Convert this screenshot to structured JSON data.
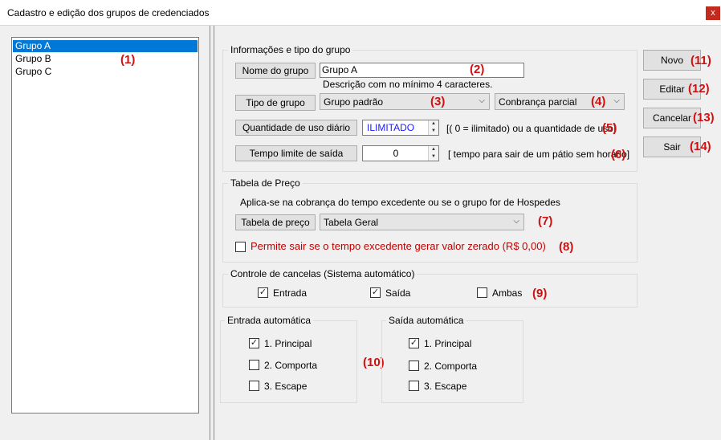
{
  "window": {
    "title": "Cadastro e edição dos grupos de credenciados",
    "close_glyph": "x"
  },
  "list": {
    "items": [
      "Grupo A",
      "Grupo B",
      "Grupo C"
    ],
    "selected_index": 0
  },
  "groups": {
    "info": "Informações e tipo do grupo",
    "price": "Tabela de Preço",
    "gates": "Controle de cancelas (Sistema automático)",
    "entry_auto": "Entrada automática",
    "exit_auto": "Saída automática"
  },
  "info": {
    "name_button": "Nome do grupo",
    "name_value": "Grupo A",
    "name_hint": "Descrição com no mínimo 4 caracteres.",
    "type_button": "Tipo de grupo",
    "type_value": "Grupo padrão",
    "charge_value": "Conbrança parcial",
    "usage_button": "Quantidade de uso diário",
    "usage_value": "ILIMITADO",
    "usage_hint": "[( 0 = ilimitado) ou a quantidade de uso]",
    "time_button": "Tempo limite de saída",
    "time_value": "0",
    "time_hint": "[ tempo para sair de um pátio sem horário]"
  },
  "price": {
    "description": "Aplica-se na cobrança do tempo excedente ou se o grupo for de Hospedes",
    "table_button": "Tabela de preço",
    "table_value": "Tabela Geral",
    "zero_checkbox_label": "Permite sair se o tempo excedente gerar valor zerado (R$ 0,00)",
    "zero_checked": false
  },
  "gates": {
    "entrada": {
      "label": "Entrada",
      "checked": true
    },
    "saida": {
      "label": "Saída",
      "checked": true
    },
    "ambas": {
      "label": "Ambas",
      "checked": false
    }
  },
  "entry_auto": [
    {
      "label": "1. Principal",
      "checked": true
    },
    {
      "label": "2. Comporta",
      "checked": false
    },
    {
      "label": "3. Escape",
      "checked": false
    }
  ],
  "exit_auto": [
    {
      "label": "1. Principal",
      "checked": true
    },
    {
      "label": "2. Comporta",
      "checked": false
    },
    {
      "label": "3. Escape",
      "checked": false
    }
  ],
  "actions": {
    "novo": "Novo",
    "editar": "Editar",
    "cancelar": "Cancelar",
    "sair": "Sair"
  },
  "markers": [
    "(1)",
    "(2)",
    "(3)",
    "(4)",
    "(5)",
    "(6)",
    "(7)",
    "(8)",
    "(9)",
    "(10)",
    "(11)",
    "(12)",
    "(13)",
    "(14)"
  ],
  "glyphs": {
    "check": "✓",
    "chevron": "⌵",
    "spin_up": "▲",
    "spin_down": "▼"
  },
  "colors": {
    "selection": "#0078d7",
    "marker": "#d01010",
    "warning_text": "#c00000",
    "usage_text": "#1a1aff"
  }
}
